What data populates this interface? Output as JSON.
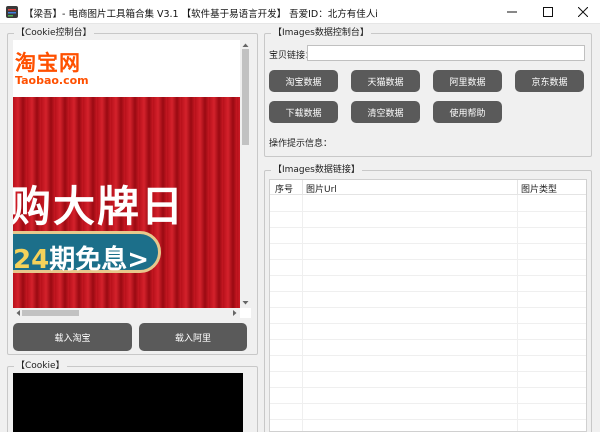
{
  "window": {
    "title": "【梁吾】- 电商图片工具箱合集 V3.1    【软件基于易语言开发】    吾爱ID：北方有佳人i"
  },
  "cookie_console": {
    "title": "【Cookie控制台】",
    "logo_cn": "淘宝网",
    "logo_en": "Taobao.com",
    "banner_headline": "购大牌日",
    "banner_num": "24",
    "banner_tail": "期免息>",
    "load_taobao_label": "载入淘宝",
    "load_ali_label": "载入阿里"
  },
  "cookie_panel": {
    "title": "【Cookie】"
  },
  "images_console": {
    "title": "【Images数据控制台】",
    "link_label": "宝贝链接：",
    "link_value": "",
    "buttons": [
      "淘宝数据",
      "天猫数据",
      "阿里数据",
      "京东数据",
      "下载数据",
      "清空数据",
      "使用帮助"
    ],
    "hint_label": "操作提示信息："
  },
  "images_links": {
    "title": "【Images数据链接】",
    "columns": [
      "序号",
      "图片Url",
      "图片类型"
    ]
  },
  "colors": {
    "button_bg": "#5a5a5a",
    "banner_red": "#c51822",
    "logo_orange": "#ff5000"
  }
}
